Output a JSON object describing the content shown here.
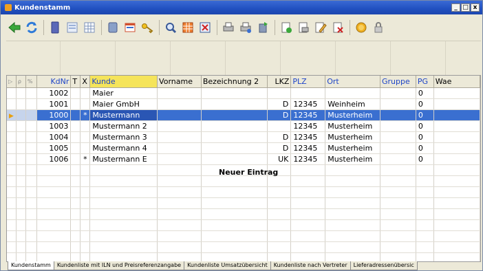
{
  "window": {
    "title": "Kundenstamm",
    "buttons": [
      "_",
      "□",
      "x"
    ]
  },
  "toolbar": {
    "buttons": [
      "arrow-left-icon",
      "refresh-icon",
      "book-icon",
      "form-view-icon",
      "table-view-icon",
      "db-icon",
      "window-icon",
      "key-icon",
      "magnify-icon",
      "grid-orange-icon",
      "delete-icon",
      "printer-icon",
      "printer-setup-icon",
      "export-icon",
      "doc-green-icon",
      "doc-print-icon",
      "edit-icon",
      "close-doc-icon",
      "coin-icon",
      "lock-icon"
    ]
  },
  "grid": {
    "columns": [
      {
        "key": "i1",
        "label": ""
      },
      {
        "key": "i2",
        "label": ""
      },
      {
        "key": "i3",
        "label": ""
      },
      {
        "key": "kdnr",
        "label": "KdNr"
      },
      {
        "key": "t",
        "label": "T"
      },
      {
        "key": "x",
        "label": "X"
      },
      {
        "key": "kunde",
        "label": "Kunde"
      },
      {
        "key": "vorname",
        "label": "Vorname"
      },
      {
        "key": "bez2",
        "label": "Bezeichnung 2"
      },
      {
        "key": "lkz",
        "label": "LKZ"
      },
      {
        "key": "plz",
        "label": "PLZ"
      },
      {
        "key": "ort",
        "label": "Ort"
      },
      {
        "key": "gruppe",
        "label": "Gruppe"
      },
      {
        "key": "pg",
        "label": "PG"
      },
      {
        "key": "wae",
        "label": "Wae"
      }
    ],
    "rows": [
      {
        "kdnr": "1002",
        "x": "",
        "kunde": "Maier",
        "lkz": "",
        "plz": "",
        "ort": "",
        "pg": "0"
      },
      {
        "kdnr": "1001",
        "x": "",
        "kunde": "Maier GmbH",
        "lkz": "D",
        "plz": "12345",
        "ort": "Weinheim",
        "pg": "0"
      },
      {
        "kdnr": "1000",
        "x": "*",
        "kunde": "Mustermann",
        "lkz": "D",
        "plz": "12345",
        "ort": "Musterheim",
        "pg": "0",
        "selected": true
      },
      {
        "kdnr": "1003",
        "x": "",
        "kunde": "Mustermann 2",
        "lkz": "",
        "plz": "12345",
        "ort": "Musterheim",
        "pg": "0"
      },
      {
        "kdnr": "1004",
        "x": "",
        "kunde": "Mustermann 3",
        "lkz": "D",
        "plz": "12345",
        "ort": "Musterheim",
        "pg": "0"
      },
      {
        "kdnr": "1005",
        "x": "",
        "kunde": "Mustermann 4",
        "lkz": "D",
        "plz": "12345",
        "ort": "Musterheim",
        "pg": "0"
      },
      {
        "kdnr": "1006",
        "x": "*",
        "kunde": "Mustermann E",
        "lkz": "UK",
        "plz": "12345",
        "ort": "Musterheim",
        "pg": "0"
      }
    ],
    "new_entry_label": "Neuer Eintrag"
  },
  "tabs": [
    "Kundenstamm",
    "Kundenliste mit ILN und Preisreferenzangabe",
    "Kundenliste Umsatzübersicht",
    "Kundenliste nach Vertreter",
    "Lieferadressenübersic"
  ],
  "colors": {
    "selection": "#3a6fd0",
    "title": "#2150c0",
    "kunde_header": "#f5e45a"
  }
}
